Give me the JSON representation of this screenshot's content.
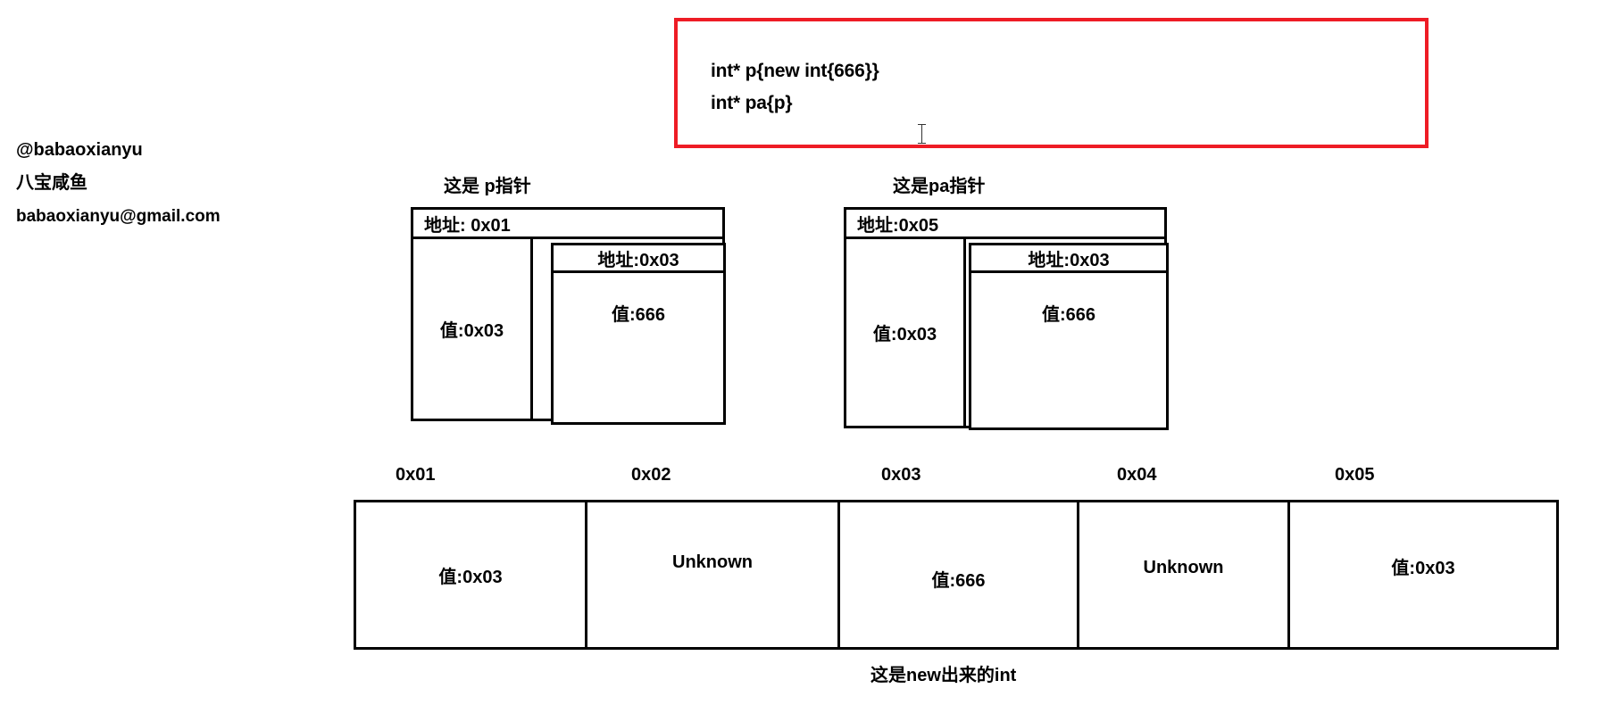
{
  "code_box": {
    "border_color": "#ee1c25",
    "lines": [
      "int* p{new int{666}}",
      "int* pa{p}"
    ]
  },
  "credits": {
    "handle": "@babaoxianyu",
    "name": "八宝咸鱼",
    "email": "babaoxianyu@gmail.com"
  },
  "pointer_p": {
    "caption": "这是 p指针",
    "outer_address": "地址: 0x01",
    "outer_value": "值:0x03",
    "inner_address": "地址:0x03",
    "inner_value": "值:666"
  },
  "pointer_pa": {
    "caption": "这是pa指针",
    "outer_address": "地址:0x05",
    "outer_value": "值:0x03",
    "inner_address": "地址:0x03",
    "inner_value": "值:666"
  },
  "memory": {
    "caption": "这是new出来的int",
    "cells": [
      {
        "address": "0x01",
        "value": "值:0x03"
      },
      {
        "address": "0x02",
        "value": "Unknown"
      },
      {
        "address": "0x03",
        "value": "值:666"
      },
      {
        "address": "0x04",
        "value": "Unknown"
      },
      {
        "address": "0x05",
        "value": "值:0x03"
      }
    ]
  }
}
